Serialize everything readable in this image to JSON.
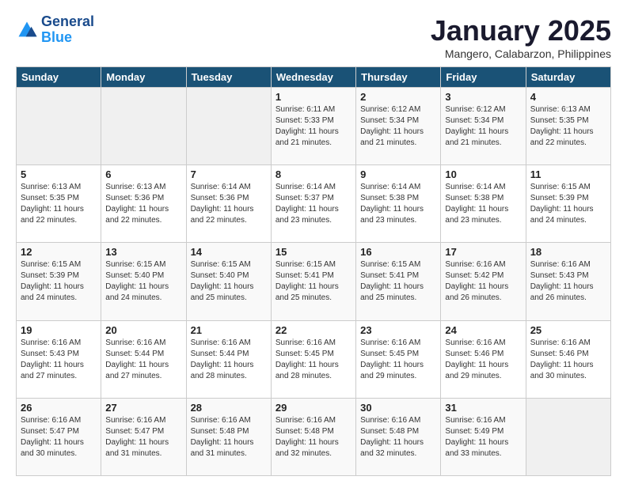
{
  "logo": {
    "line1": "General",
    "line2": "Blue"
  },
  "title": "January 2025",
  "location": "Mangero, Calabarzon, Philippines",
  "days_of_week": [
    "Sunday",
    "Monday",
    "Tuesday",
    "Wednesday",
    "Thursday",
    "Friday",
    "Saturday"
  ],
  "weeks": [
    [
      {
        "day": "",
        "info": ""
      },
      {
        "day": "",
        "info": ""
      },
      {
        "day": "",
        "info": ""
      },
      {
        "day": "1",
        "info": "Sunrise: 6:11 AM\nSunset: 5:33 PM\nDaylight: 11 hours\nand 21 minutes."
      },
      {
        "day": "2",
        "info": "Sunrise: 6:12 AM\nSunset: 5:34 PM\nDaylight: 11 hours\nand 21 minutes."
      },
      {
        "day": "3",
        "info": "Sunrise: 6:12 AM\nSunset: 5:34 PM\nDaylight: 11 hours\nand 21 minutes."
      },
      {
        "day": "4",
        "info": "Sunrise: 6:13 AM\nSunset: 5:35 PM\nDaylight: 11 hours\nand 22 minutes."
      }
    ],
    [
      {
        "day": "5",
        "info": "Sunrise: 6:13 AM\nSunset: 5:35 PM\nDaylight: 11 hours\nand 22 minutes."
      },
      {
        "day": "6",
        "info": "Sunrise: 6:13 AM\nSunset: 5:36 PM\nDaylight: 11 hours\nand 22 minutes."
      },
      {
        "day": "7",
        "info": "Sunrise: 6:14 AM\nSunset: 5:36 PM\nDaylight: 11 hours\nand 22 minutes."
      },
      {
        "day": "8",
        "info": "Sunrise: 6:14 AM\nSunset: 5:37 PM\nDaylight: 11 hours\nand 23 minutes."
      },
      {
        "day": "9",
        "info": "Sunrise: 6:14 AM\nSunset: 5:38 PM\nDaylight: 11 hours\nand 23 minutes."
      },
      {
        "day": "10",
        "info": "Sunrise: 6:14 AM\nSunset: 5:38 PM\nDaylight: 11 hours\nand 23 minutes."
      },
      {
        "day": "11",
        "info": "Sunrise: 6:15 AM\nSunset: 5:39 PM\nDaylight: 11 hours\nand 24 minutes."
      }
    ],
    [
      {
        "day": "12",
        "info": "Sunrise: 6:15 AM\nSunset: 5:39 PM\nDaylight: 11 hours\nand 24 minutes."
      },
      {
        "day": "13",
        "info": "Sunrise: 6:15 AM\nSunset: 5:40 PM\nDaylight: 11 hours\nand 24 minutes."
      },
      {
        "day": "14",
        "info": "Sunrise: 6:15 AM\nSunset: 5:40 PM\nDaylight: 11 hours\nand 25 minutes."
      },
      {
        "day": "15",
        "info": "Sunrise: 6:15 AM\nSunset: 5:41 PM\nDaylight: 11 hours\nand 25 minutes."
      },
      {
        "day": "16",
        "info": "Sunrise: 6:15 AM\nSunset: 5:41 PM\nDaylight: 11 hours\nand 25 minutes."
      },
      {
        "day": "17",
        "info": "Sunrise: 6:16 AM\nSunset: 5:42 PM\nDaylight: 11 hours\nand 26 minutes."
      },
      {
        "day": "18",
        "info": "Sunrise: 6:16 AM\nSunset: 5:43 PM\nDaylight: 11 hours\nand 26 minutes."
      }
    ],
    [
      {
        "day": "19",
        "info": "Sunrise: 6:16 AM\nSunset: 5:43 PM\nDaylight: 11 hours\nand 27 minutes."
      },
      {
        "day": "20",
        "info": "Sunrise: 6:16 AM\nSunset: 5:44 PM\nDaylight: 11 hours\nand 27 minutes."
      },
      {
        "day": "21",
        "info": "Sunrise: 6:16 AM\nSunset: 5:44 PM\nDaylight: 11 hours\nand 28 minutes."
      },
      {
        "day": "22",
        "info": "Sunrise: 6:16 AM\nSunset: 5:45 PM\nDaylight: 11 hours\nand 28 minutes."
      },
      {
        "day": "23",
        "info": "Sunrise: 6:16 AM\nSunset: 5:45 PM\nDaylight: 11 hours\nand 29 minutes."
      },
      {
        "day": "24",
        "info": "Sunrise: 6:16 AM\nSunset: 5:46 PM\nDaylight: 11 hours\nand 29 minutes."
      },
      {
        "day": "25",
        "info": "Sunrise: 6:16 AM\nSunset: 5:46 PM\nDaylight: 11 hours\nand 30 minutes."
      }
    ],
    [
      {
        "day": "26",
        "info": "Sunrise: 6:16 AM\nSunset: 5:47 PM\nDaylight: 11 hours\nand 30 minutes."
      },
      {
        "day": "27",
        "info": "Sunrise: 6:16 AM\nSunset: 5:47 PM\nDaylight: 11 hours\nand 31 minutes."
      },
      {
        "day": "28",
        "info": "Sunrise: 6:16 AM\nSunset: 5:48 PM\nDaylight: 11 hours\nand 31 minutes."
      },
      {
        "day": "29",
        "info": "Sunrise: 6:16 AM\nSunset: 5:48 PM\nDaylight: 11 hours\nand 32 minutes."
      },
      {
        "day": "30",
        "info": "Sunrise: 6:16 AM\nSunset: 5:48 PM\nDaylight: 11 hours\nand 32 minutes."
      },
      {
        "day": "31",
        "info": "Sunrise: 6:16 AM\nSunset: 5:49 PM\nDaylight: 11 hours\nand 33 minutes."
      },
      {
        "day": "",
        "info": ""
      }
    ]
  ]
}
